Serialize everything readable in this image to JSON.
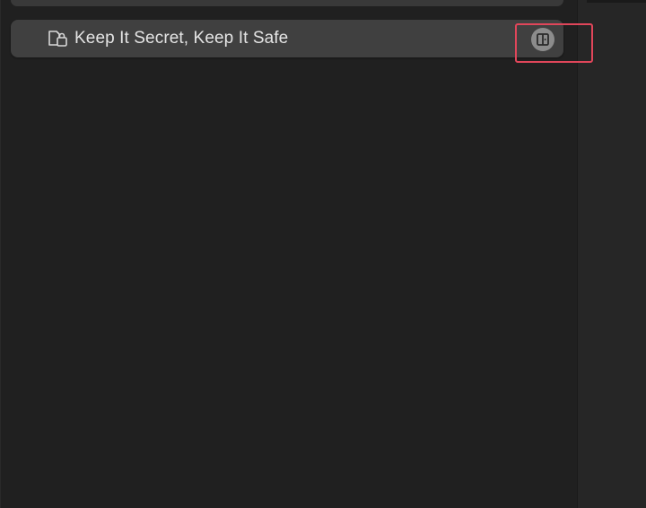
{
  "vault_list": {
    "items": [
      {
        "label": "Keep It Secret, Keep It Safe",
        "icon": "locked-vault-icon",
        "action_icon": "open-vault-icon"
      }
    ]
  },
  "colors": {
    "background": "#202020",
    "side_panel": "#262626",
    "row": "#404040",
    "text": "#e4e4e4",
    "highlight": "#e0465a"
  }
}
